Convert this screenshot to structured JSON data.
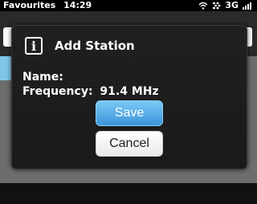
{
  "status_bar": {
    "carrier_label": "Favourites",
    "time": "14:29",
    "network": "3G",
    "icons": [
      "wifi-icon",
      "blackberry-icon",
      "signal-icon"
    ]
  },
  "dialog": {
    "icon": "info-icon",
    "icon_glyph": "i",
    "title": "Add Station",
    "name_label": "Name:",
    "name_value": "",
    "frequency_label": "Frequency:",
    "frequency_value": "91.4 MHz",
    "save_label": "Save",
    "cancel_label": "Cancel"
  },
  "colors": {
    "accent": "#3a95d8",
    "dialog_bg": "#1c1c1c"
  }
}
